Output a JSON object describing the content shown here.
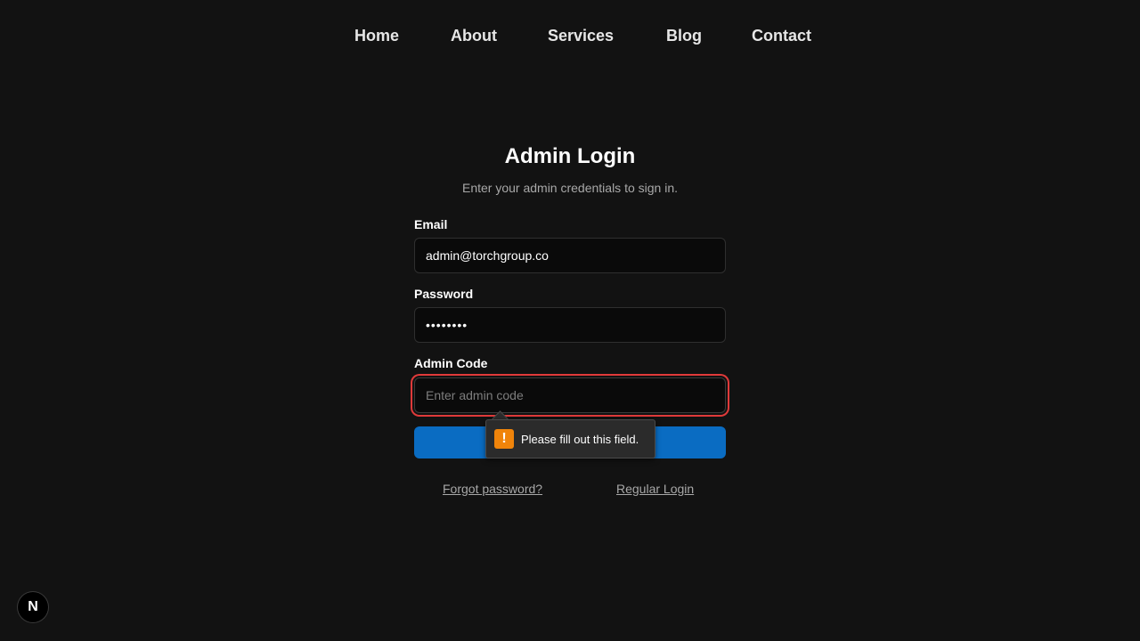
{
  "nav": {
    "items": [
      {
        "label": "Home"
      },
      {
        "label": "About"
      },
      {
        "label": "Services"
      },
      {
        "label": "Blog"
      },
      {
        "label": "Contact"
      }
    ]
  },
  "login": {
    "title": "Admin Login",
    "subtitle": "Enter your admin credentials to sign in.",
    "email": {
      "label": "Email",
      "value": "admin@torchgroup.co"
    },
    "password": {
      "label": "Password",
      "masked_value": "••••••••"
    },
    "admin_code": {
      "label": "Admin Code",
      "placeholder": "Enter admin code",
      "value": ""
    },
    "submit_label": "",
    "forgot_password": "Forgot password?",
    "regular_login": "Regular Login"
  },
  "validation_tooltip": {
    "icon": "warning-icon",
    "icon_glyph": "!",
    "message": "Please fill out this field.",
    "icon_color": "#f0840a"
  },
  "dev_badge": {
    "icon": "nextjs-icon",
    "glyph": "N"
  },
  "colors": {
    "background": "#121212",
    "accent": "#0a6cc2",
    "error": "#e03a3a"
  }
}
